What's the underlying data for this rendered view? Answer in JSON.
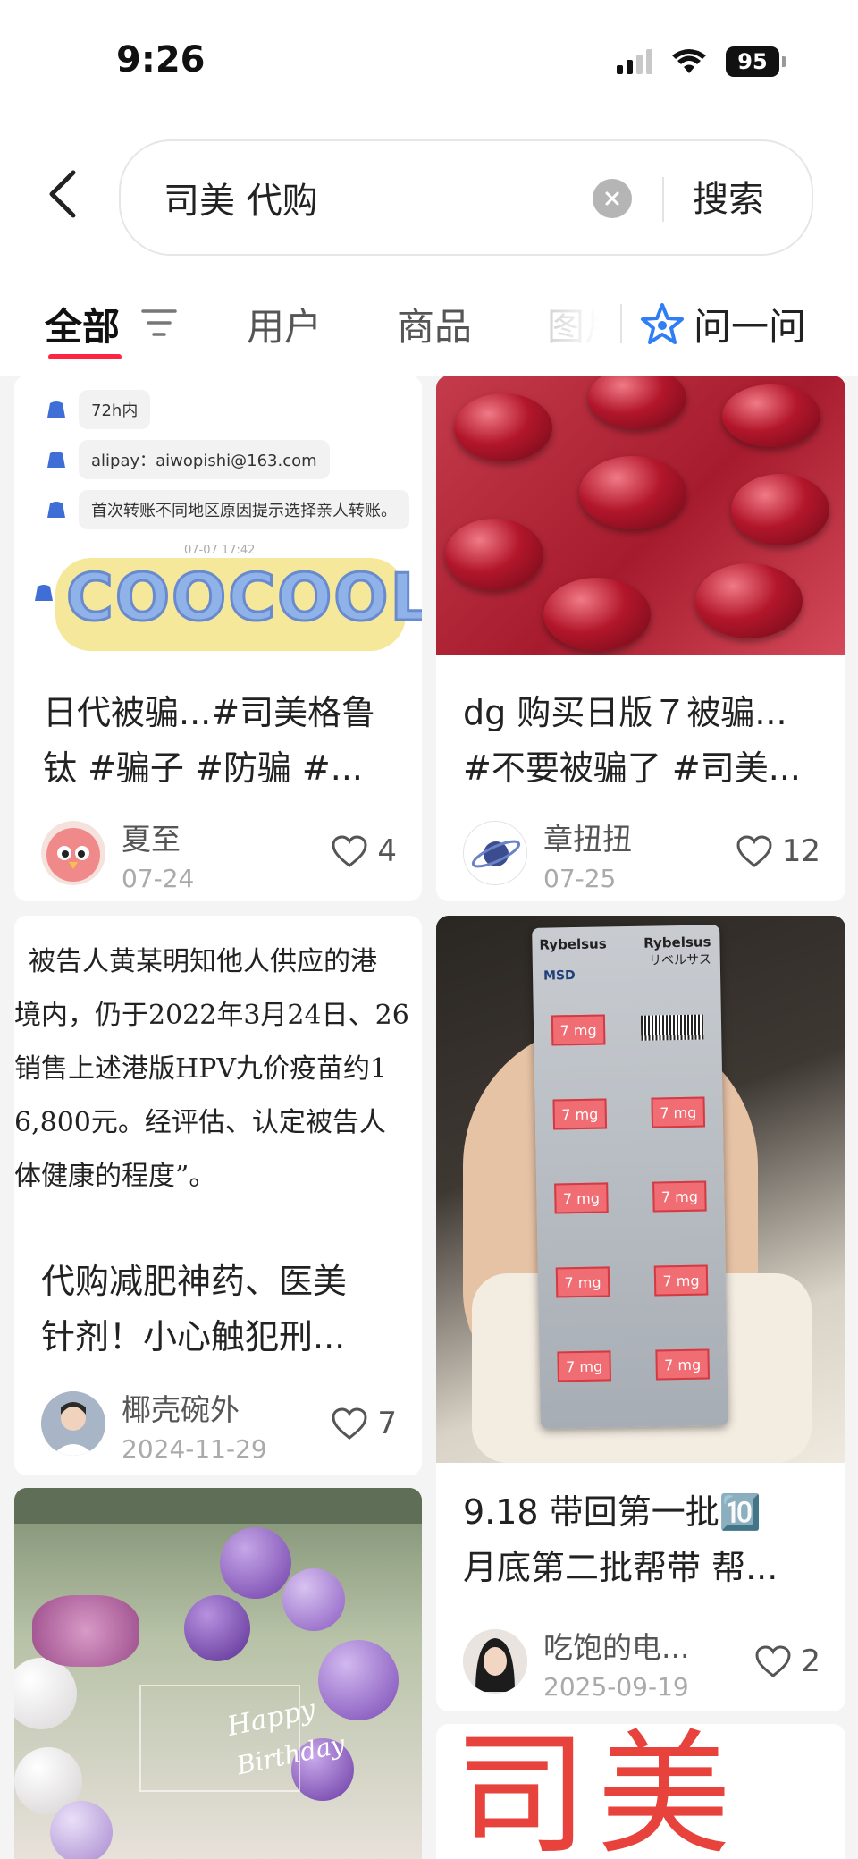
{
  "status": {
    "time": "9:26",
    "battery": "95"
  },
  "search": {
    "query": "司美 代购",
    "button_label": "搜索"
  },
  "tabs": [
    {
      "label": "全部",
      "active": true
    },
    {
      "label": "用户"
    },
    {
      "label": "商品"
    },
    {
      "label": "图片"
    }
  ],
  "ask": {
    "label": "问一问"
  },
  "cards": [
    {
      "title_line1": "日代被骗...#司美格鲁",
      "title_line2": "钛 #骗子 #防骗 #...",
      "author": "夏至",
      "date": "07-24",
      "likes": "4",
      "image": {
        "messages": [
          "72h内",
          "alipay：aiwopishi@163.com",
          "首次转账不同地区原因提示选择亲人转账。"
        ],
        "timestamp": "07-07 17:42",
        "sticker_text": "COOCOOL"
      }
    },
    {
      "title_line1": "dg 购买日版７被骗...",
      "title_line2": "#不要被骗了 #司美...",
      "author": "章扭扭",
      "date": "07-25",
      "likes": "12"
    },
    {
      "title_line1": "代购减肥神药、医美",
      "title_line2": "针剂！小心触犯刑...",
      "author": "椰壳碗外",
      "date": "2024-11-29",
      "likes": "7",
      "image": {
        "lines": [
          "被告人黄某明知他人供应的港",
          "境内，仍于2022年3月24日、26",
          "销售上述港版HPV九价疫苗约1",
          "6,800元。经评估、认定被告人",
          "体健康的程度”。"
        ]
      }
    },
    {
      "title_line1": "9.18 带回第一批🔟",
      "title_line2": "月底第二批帮带 帮...",
      "author": "吃饱的电...",
      "date": "2025-09-19",
      "likes": "2",
      "image": {
        "brand": "Rybelsus",
        "brand_jp": "リベルサス",
        "maker": "MSD",
        "dose": "7 mg"
      }
    },
    {
      "image": {
        "sign_line1": "Happy",
        "sign_line2": "Birthday"
      }
    },
    {
      "image": {
        "handwriting": "司美"
      }
    }
  ],
  "colors": {
    "accent": "#ff2442",
    "background": "#f4f4f4",
    "card": "#ffffff"
  },
  "icons": [
    "back-arrow-icon",
    "clear-icon",
    "filter-icon",
    "ask-star-icon",
    "heart-icon",
    "signal-icon",
    "wifi-icon",
    "battery-icon"
  ]
}
